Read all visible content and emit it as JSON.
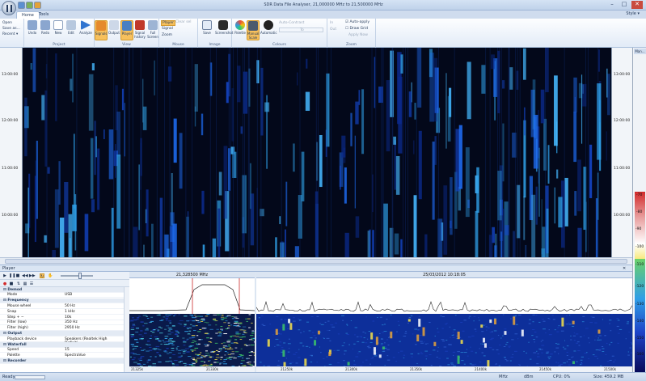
{
  "window": {
    "title": "SDR Data File Analyser, 21,000000 MHz to 21,500000 MHz",
    "min": "–",
    "max": "□",
    "close": "✕"
  },
  "tabs": [
    {
      "label": "Home",
      "active": true
    },
    {
      "label": "Tools",
      "active": false
    }
  ],
  "style_label": "Style ▾",
  "ribbon": {
    "file_items": [
      "Open",
      "Save as...",
      "Recent ▾"
    ],
    "project": {
      "label": "Project",
      "buttons": [
        "Undo",
        "Redo",
        "New",
        "Edit",
        "Analyze"
      ]
    },
    "view": {
      "label": "View",
      "buttons": [
        "Signals",
        "Output",
        "Player",
        "Signal history",
        "Full Screen"
      ]
    },
    "mouse": {
      "label": "Mouse",
      "player": "Player",
      "clear": "Clear sel",
      "signal": "Signal",
      "zoom": "Zoom"
    },
    "image": {
      "label": "Image",
      "buttons": [
        "Save",
        "Screenshot"
      ]
    },
    "colours": {
      "label": "Colours",
      "buttons": [
        "Palette",
        "Manual Scale",
        "Automatic"
      ],
      "auto_contrast": "Auto-Contrast",
      "to": "To"
    },
    "zoom": {
      "label": "Zoom",
      "in": "In",
      "out": "Out",
      "auto_apply": "Auto-apply",
      "draw_grid": "Draw Grid",
      "apply_now": "Apply Now"
    }
  },
  "time_ticks": [
    "13:00:00",
    "12:00:00",
    "11:00:00",
    "10:00:00"
  ],
  "db_scale": {
    "title": "Man...",
    "labels": [
      "-70",
      "-80",
      "-90",
      "-100",
      "-110",
      "-120",
      "-130",
      "-140",
      "-150",
      "-160"
    ]
  },
  "panel": {
    "title": "Player"
  },
  "properties": [
    {
      "cat": true,
      "k": "Demod"
    },
    {
      "k": "Mode",
      "v": "USB"
    },
    {
      "cat": true,
      "k": "Frequency"
    },
    {
      "k": "Mouse wheel",
      "v": "50 Hz"
    },
    {
      "k": "Snap",
      "v": "1 kHz"
    },
    {
      "k": "Step + −",
      "v": "10k"
    },
    {
      "k": "Filter (low)",
      "v": "350 Hz"
    },
    {
      "k": "Filter (high)",
      "v": "2950 Hz"
    },
    {
      "cat": true,
      "k": "Output"
    },
    {
      "k": "Playback device",
      "v": "Speakers (Realtek High Definiti..."
    },
    {
      "cat": true,
      "k": "Waterfall"
    },
    {
      "k": "Speed",
      "v": "15"
    },
    {
      "k": "Palette",
      "v": "SpectraVue"
    },
    {
      "cat": true,
      "k": "Recorder"
    }
  ],
  "spec1": {
    "freq": "21,328500 MHz",
    "axis": [
      "21325k",
      "21330k"
    ]
  },
  "spec2": {
    "datetime": "25/03/2012 10:18:05",
    "axis": [
      "21250k",
      "21300k",
      "21350k",
      "21400k",
      "21450k",
      "21500k"
    ]
  },
  "status": {
    "ready": "Ready",
    "mhz": "MHz",
    "dbm": "dBm",
    "cpu": "CPU: 0%",
    "size": "Size: 459.2 MB"
  },
  "colors": {
    "accent": "#f7c05c",
    "ribbon": "#e2ebf7",
    "waterfall_bg": "#020409"
  }
}
